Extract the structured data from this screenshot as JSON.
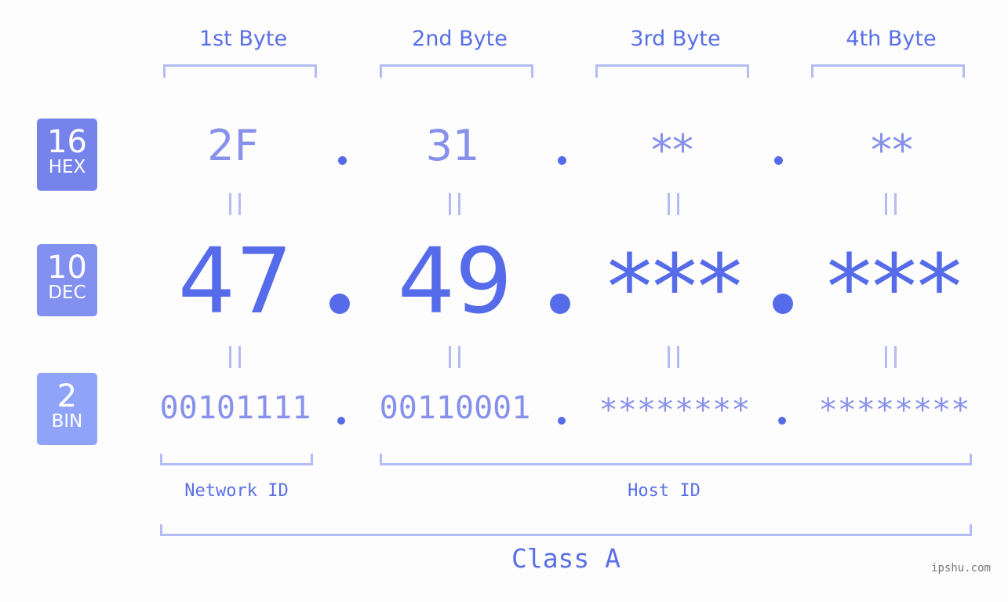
{
  "headers": [
    "1st Byte",
    "2nd Byte",
    "3rd Byte",
    "4th Byte"
  ],
  "badges": [
    {
      "number": "16",
      "label": "HEX",
      "color": "#7583ea"
    },
    {
      "number": "10",
      "label": "DEC",
      "color": "#8291f0"
    },
    {
      "number": "2",
      "label": "BIN",
      "color": "#8fa4f8"
    }
  ],
  "hex": [
    "2F",
    "31",
    "**",
    "**"
  ],
  "dec": [
    "47",
    "49",
    "***",
    "***"
  ],
  "bin": [
    "00101111",
    "00110001",
    "********",
    "********"
  ],
  "equals": "=",
  "network_label": "Network ID",
  "host_label": "Host ID",
  "class_label": "Class A",
  "watermark": "ipshu.com",
  "colors": {
    "accent": "#566be9",
    "light": "#8791ec",
    "bracket": "#b3bcf5"
  }
}
